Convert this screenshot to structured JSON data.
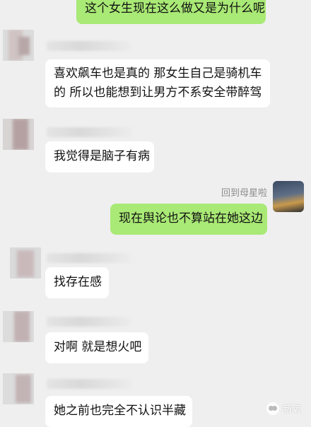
{
  "messages": [
    {
      "id": "m1",
      "side": "out",
      "text": "这个女生现在这么做又是为什么呢"
    },
    {
      "id": "m2",
      "side": "in",
      "lines": [
        "喜欢飙车也是真的 那女生自己是骑机车",
        "的 所以也能想到让男方不系安全带醉驾"
      ]
    },
    {
      "id": "m3",
      "side": "in",
      "text": "我觉得是脑子有病"
    },
    {
      "id": "m4",
      "side": "out",
      "quote": "回到母星啦",
      "text": "现在舆论也不算站在她这边"
    },
    {
      "id": "m5",
      "side": "in",
      "text": "找存在感"
    },
    {
      "id": "m6",
      "side": "in",
      "text": "对啊 就是想火吧"
    },
    {
      "id": "m7",
      "side": "in",
      "text": "她之前也完全不认识半藏"
    }
  ],
  "watermark": {
    "icon": "wechat-icon",
    "text": "新氧"
  },
  "colors": {
    "background": "#efefef",
    "incoming_bubble": "#ffffff",
    "outgoing_bubble": "#a9e975"
  }
}
